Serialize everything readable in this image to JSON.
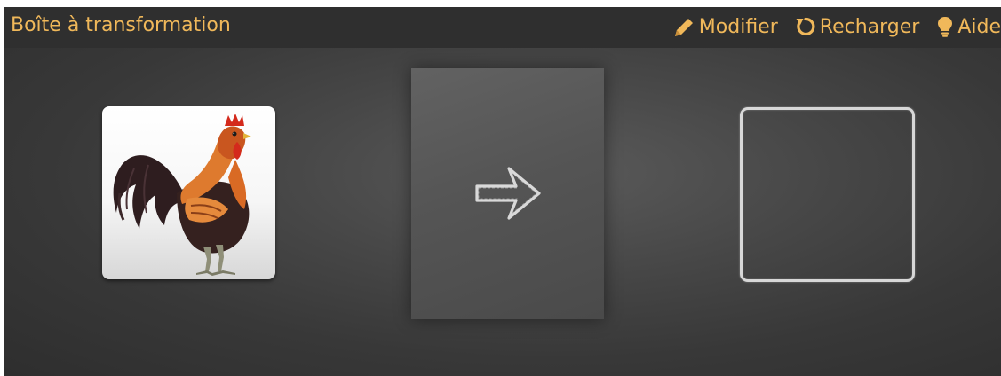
{
  "window": {
    "title": "Boîte à transformation"
  },
  "toolbar": {
    "edit_label": "Modifier",
    "reload_label": "Recharger",
    "help_label": "Aide"
  },
  "board": {
    "input_image": "rooster-image",
    "machine_icon": "arrow-right-icon",
    "output_state": "empty"
  },
  "colors": {
    "accent": "#f0b85a",
    "titlebar": "#2f2f2f",
    "board": "#474747",
    "chalk": "#e8e8e8"
  }
}
